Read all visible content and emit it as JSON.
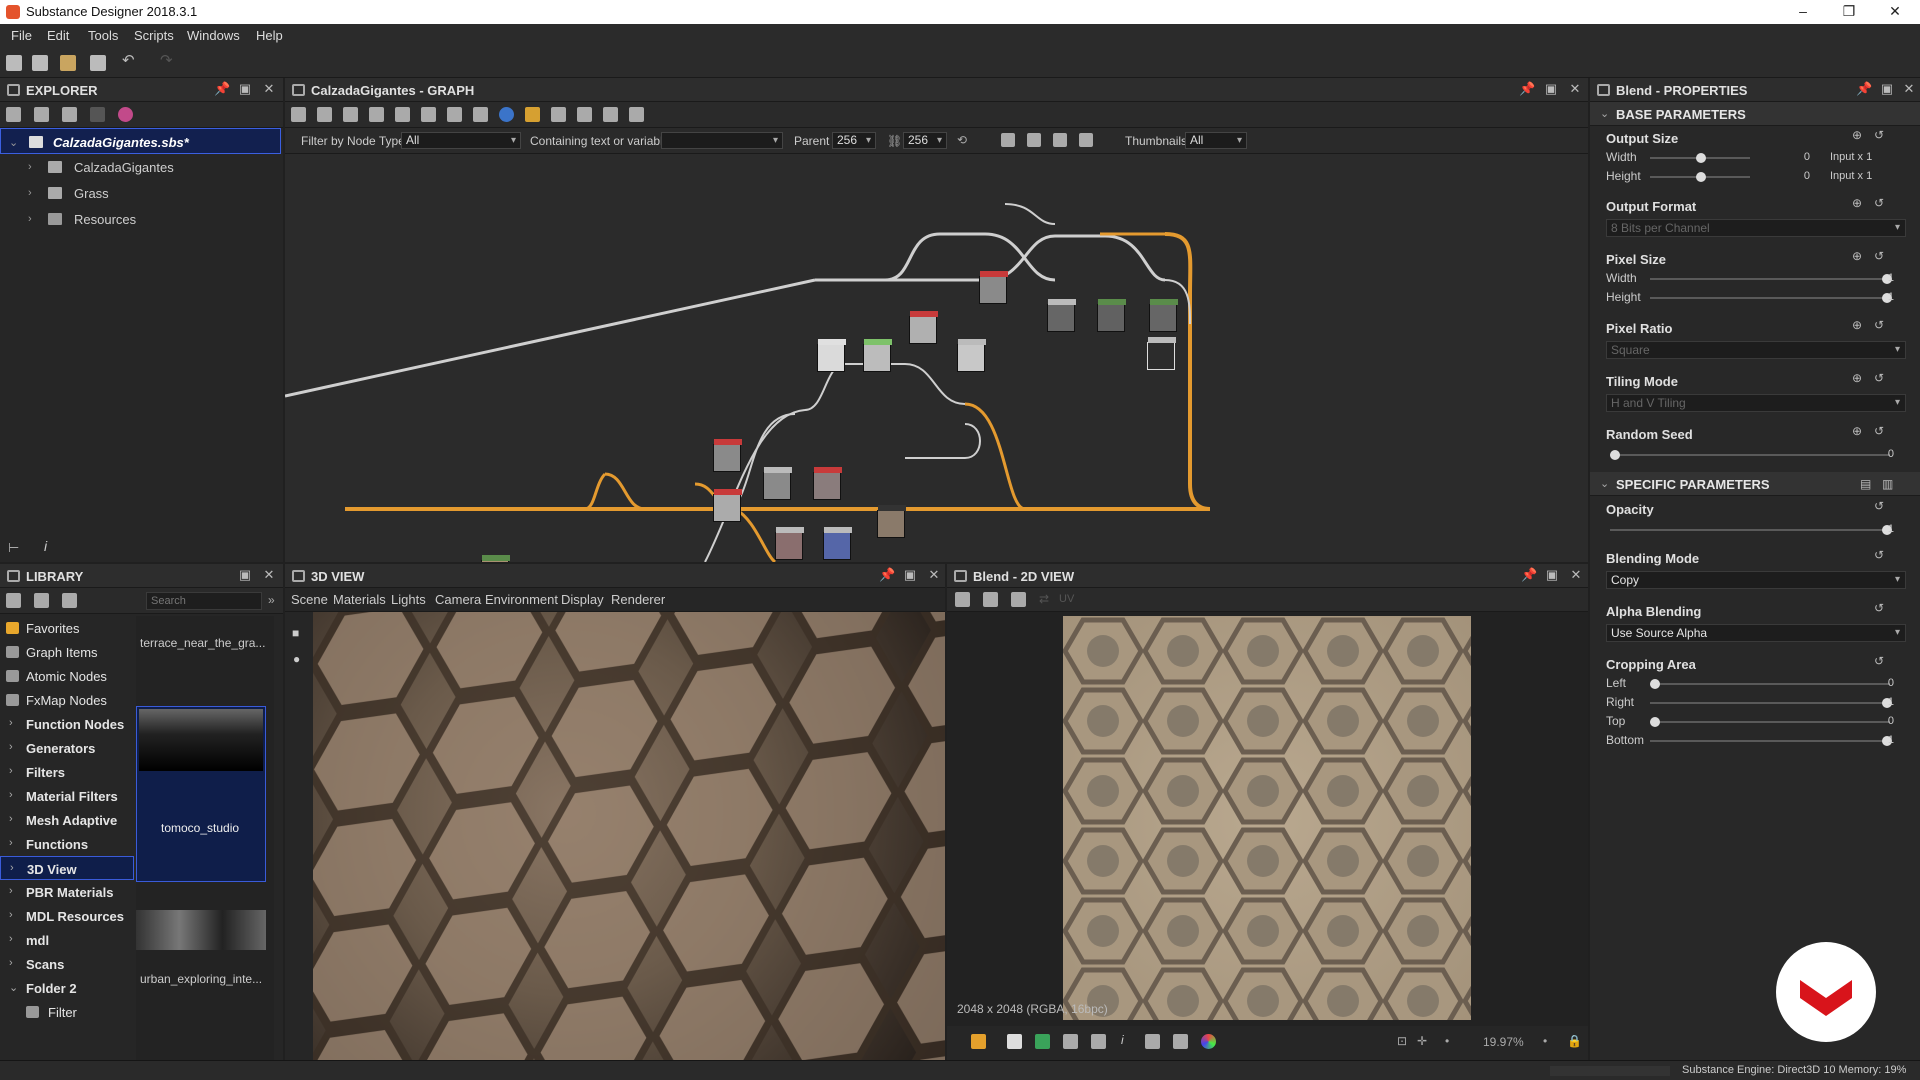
{
  "window": {
    "title": "Substance Designer 2018.3.1"
  },
  "menu": [
    "File",
    "Edit",
    "Tools",
    "Scripts",
    "Windows",
    "Help"
  ],
  "explorer": {
    "title": "EXPLORER",
    "root": "CalzadaGigantes.sbs*",
    "items": [
      {
        "label": "CalzadaGigantes"
      },
      {
        "label": "Grass"
      },
      {
        "label": "Resources"
      }
    ]
  },
  "graph": {
    "title": "CalzadaGigantes - GRAPH",
    "filter_label": "Filter by Node Type",
    "filter_value": "All",
    "containing_label": "Containing text or variable",
    "containing_value": "",
    "parent_size_label": "Parent Size:",
    "parent_w": "256",
    "parent_h": "256",
    "thumbnails_label": "Thumbnails:",
    "thumbnails_value": "All"
  },
  "library": {
    "title": "LIBRARY",
    "search_placeholder": "Search",
    "categories": [
      {
        "label": "Favorites",
        "type": "icon"
      },
      {
        "label": "Graph Items",
        "type": "icon"
      },
      {
        "label": "Atomic Nodes",
        "type": "icon"
      },
      {
        "label": "FxMap Nodes",
        "type": "icon"
      },
      {
        "label": "Function Nodes",
        "type": "folder"
      },
      {
        "label": "Generators",
        "type": "folder"
      },
      {
        "label": "Filters",
        "type": "folder"
      },
      {
        "label": "Material Filters",
        "type": "folder"
      },
      {
        "label": "Mesh Adaptive",
        "type": "folder"
      },
      {
        "label": "Functions",
        "type": "folder"
      },
      {
        "label": "3D View",
        "type": "folder"
      },
      {
        "label": "PBR Materials",
        "type": "folder"
      },
      {
        "label": "MDL Resources",
        "type": "folder"
      },
      {
        "label": "mdl",
        "type": "folder"
      },
      {
        "label": "Scans",
        "type": "folder"
      },
      {
        "label": "Folder 2",
        "type": "open"
      },
      {
        "label": "Filter",
        "type": "sub"
      }
    ],
    "thumbs": [
      {
        "label": "terrace_near_the_gra..."
      },
      {
        "label": "tomoco_studio"
      },
      {
        "label": "urban_exploring_inte..."
      }
    ]
  },
  "view3d": {
    "title": "3D VIEW",
    "menu": [
      "Scene",
      "Materials",
      "Lights",
      "Camera",
      "Environment",
      "Display",
      "Renderer"
    ]
  },
  "view2d": {
    "title": "Blend - 2D VIEW",
    "info": "2048 x 2048 (RGBA, 16bpc)",
    "zoom": "19.97%",
    "channel_label": "UV"
  },
  "props": {
    "title": "Blend - PROPERTIES",
    "base_section": "BASE PARAMETERS",
    "output_size": {
      "label": "Output Size",
      "width_label": "Width",
      "height_label": "Height",
      "width_value": "0",
      "height_value": "0",
      "width_rel": "Input x 1",
      "height_rel": "Input x 1"
    },
    "output_format": {
      "label": "Output Format",
      "value": "8 Bits per Channel"
    },
    "pixel_size": {
      "label": "Pixel Size",
      "width_label": "Width",
      "height_label": "Height",
      "width_value": "1",
      "height_value": "1"
    },
    "pixel_ratio": {
      "label": "Pixel Ratio",
      "value": "Square"
    },
    "tiling_mode": {
      "label": "Tiling Mode",
      "value": "H and V Tiling"
    },
    "random_seed": {
      "label": "Random Seed",
      "value": "0"
    },
    "specific_section": "SPECIFIC PARAMETERS",
    "opacity": {
      "label": "Opacity",
      "value": "1"
    },
    "blending_mode": {
      "label": "Blending Mode",
      "value": "Copy"
    },
    "alpha_blending": {
      "label": "Alpha Blending",
      "value": "Use Source Alpha"
    },
    "cropping": {
      "label": "Cropping Area",
      "left_label": "Left",
      "right_label": "Right",
      "top_label": "Top",
      "bottom_label": "Bottom",
      "left": "0",
      "right": "1",
      "top": "0",
      "bottom": "1"
    }
  },
  "status": {
    "engine": "Substance Engine: Direct3D 10  Memory: 19%"
  }
}
